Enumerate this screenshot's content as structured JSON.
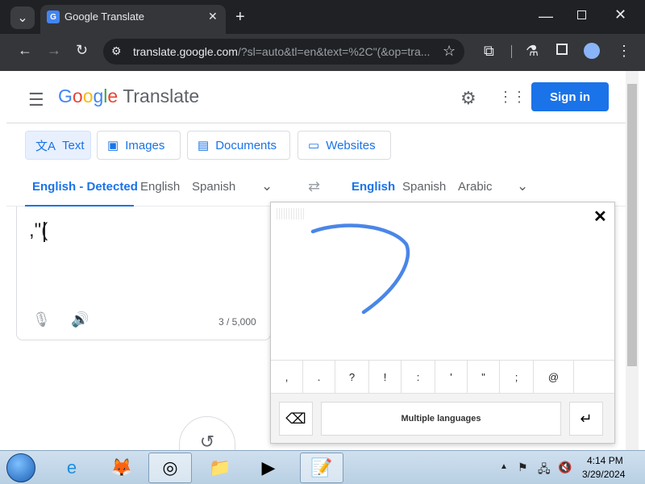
{
  "browser": {
    "tab_title": "Google Translate",
    "url_host": "translate.google.com",
    "url_path": "/?sl=auto&tl=en&text=%2C\"(&op=tra..."
  },
  "header": {
    "logo_google": [
      "G",
      "o",
      "o",
      "g",
      "l",
      "e"
    ],
    "logo_product": "Translate",
    "signin_label": "Sign in"
  },
  "modes": [
    {
      "label": "Text",
      "icon": "translate-icon"
    },
    {
      "label": "Images",
      "icon": "image-icon"
    },
    {
      "label": "Documents",
      "icon": "document-icon"
    },
    {
      "label": "Websites",
      "icon": "website-icon"
    }
  ],
  "source_langs": [
    "English - Detected",
    "English",
    "Spanish"
  ],
  "target_langs": [
    "English",
    "Spanish",
    "Arabic"
  ],
  "source": {
    "text": ",\"(",
    "char_count": "3 / 5,000"
  },
  "handwriting": {
    "symbols": [
      ",",
      ".",
      "?",
      "!",
      ":",
      "'",
      "\"",
      ";",
      "@",
      ""
    ],
    "multi_label": "Multiple languages"
  },
  "taskbar": {
    "time": "4:14 PM",
    "date": "3/29/2024"
  }
}
